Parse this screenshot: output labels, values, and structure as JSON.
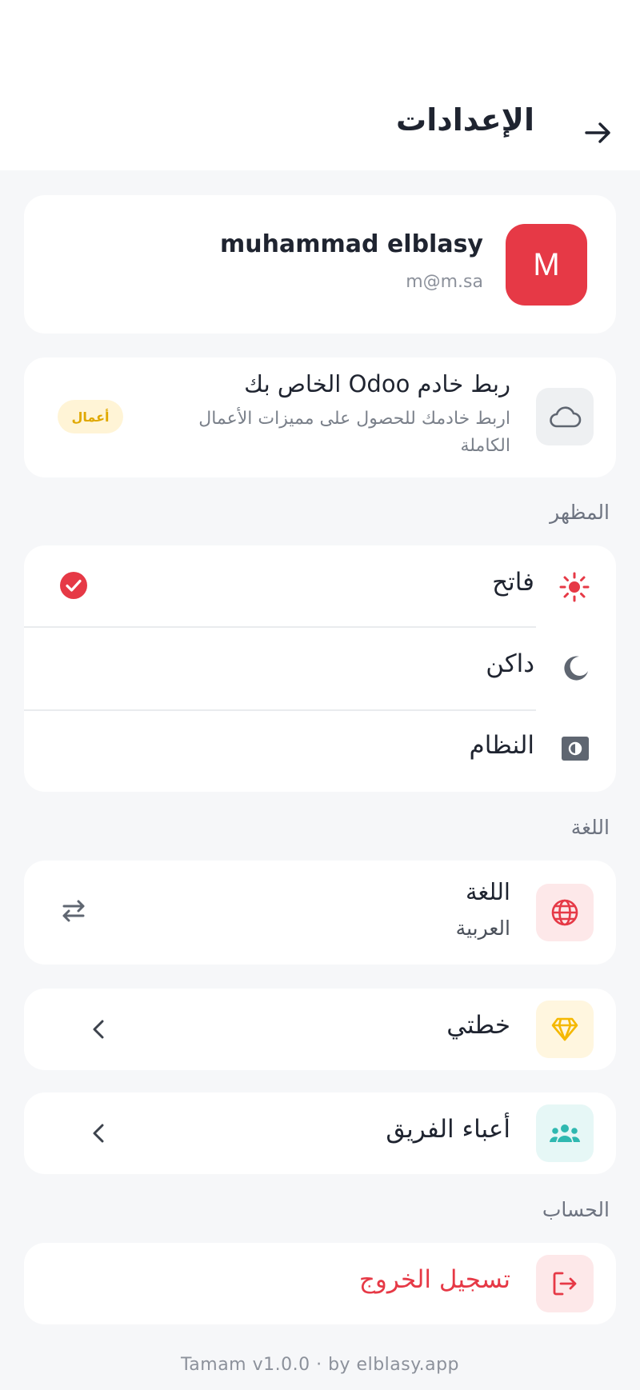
{
  "header": {
    "title": "الإعدادات",
    "back_icon": "arrow-right-icon"
  },
  "profile": {
    "avatar_initial": "M",
    "name": "muhammad elblasy",
    "email": "m@m.sa",
    "avatar_color": "#e63946"
  },
  "odoo": {
    "title": "ربط خادم Odoo الخاص بك",
    "description": "اربط خادمك للحصول على مميزات الأعمال الكاملة",
    "badge": "أعمال",
    "icon": "cloud-icon"
  },
  "appearance": {
    "label": "المظهر",
    "options": [
      {
        "label": "فاتح",
        "icon": "sun-icon",
        "selected": true
      },
      {
        "label": "داكن",
        "icon": "moon-icon",
        "selected": false
      },
      {
        "label": "النظام",
        "icon": "brightness-icon",
        "selected": false
      }
    ]
  },
  "language": {
    "label": "اللغة",
    "row_title": "اللغة",
    "row_value": "العربية",
    "icon": "globe-icon",
    "action_icon": "swap-icon"
  },
  "plan": {
    "label": "خطتي",
    "icon": "diamond-icon"
  },
  "team": {
    "label": "أعباء الفريق",
    "icon": "team-icon"
  },
  "account": {
    "label": "الحساب",
    "logout_label": "تسجيل الخروج",
    "icon": "logout-icon"
  },
  "footer": {
    "text": "Tamam v1.0.0 · by elblasy.app"
  },
  "colors": {
    "accent": "#e63946",
    "badge_bg": "#fff4d6",
    "badge_text": "#e0a800",
    "plan": "#f5b800",
    "team": "#2fb8b0"
  }
}
